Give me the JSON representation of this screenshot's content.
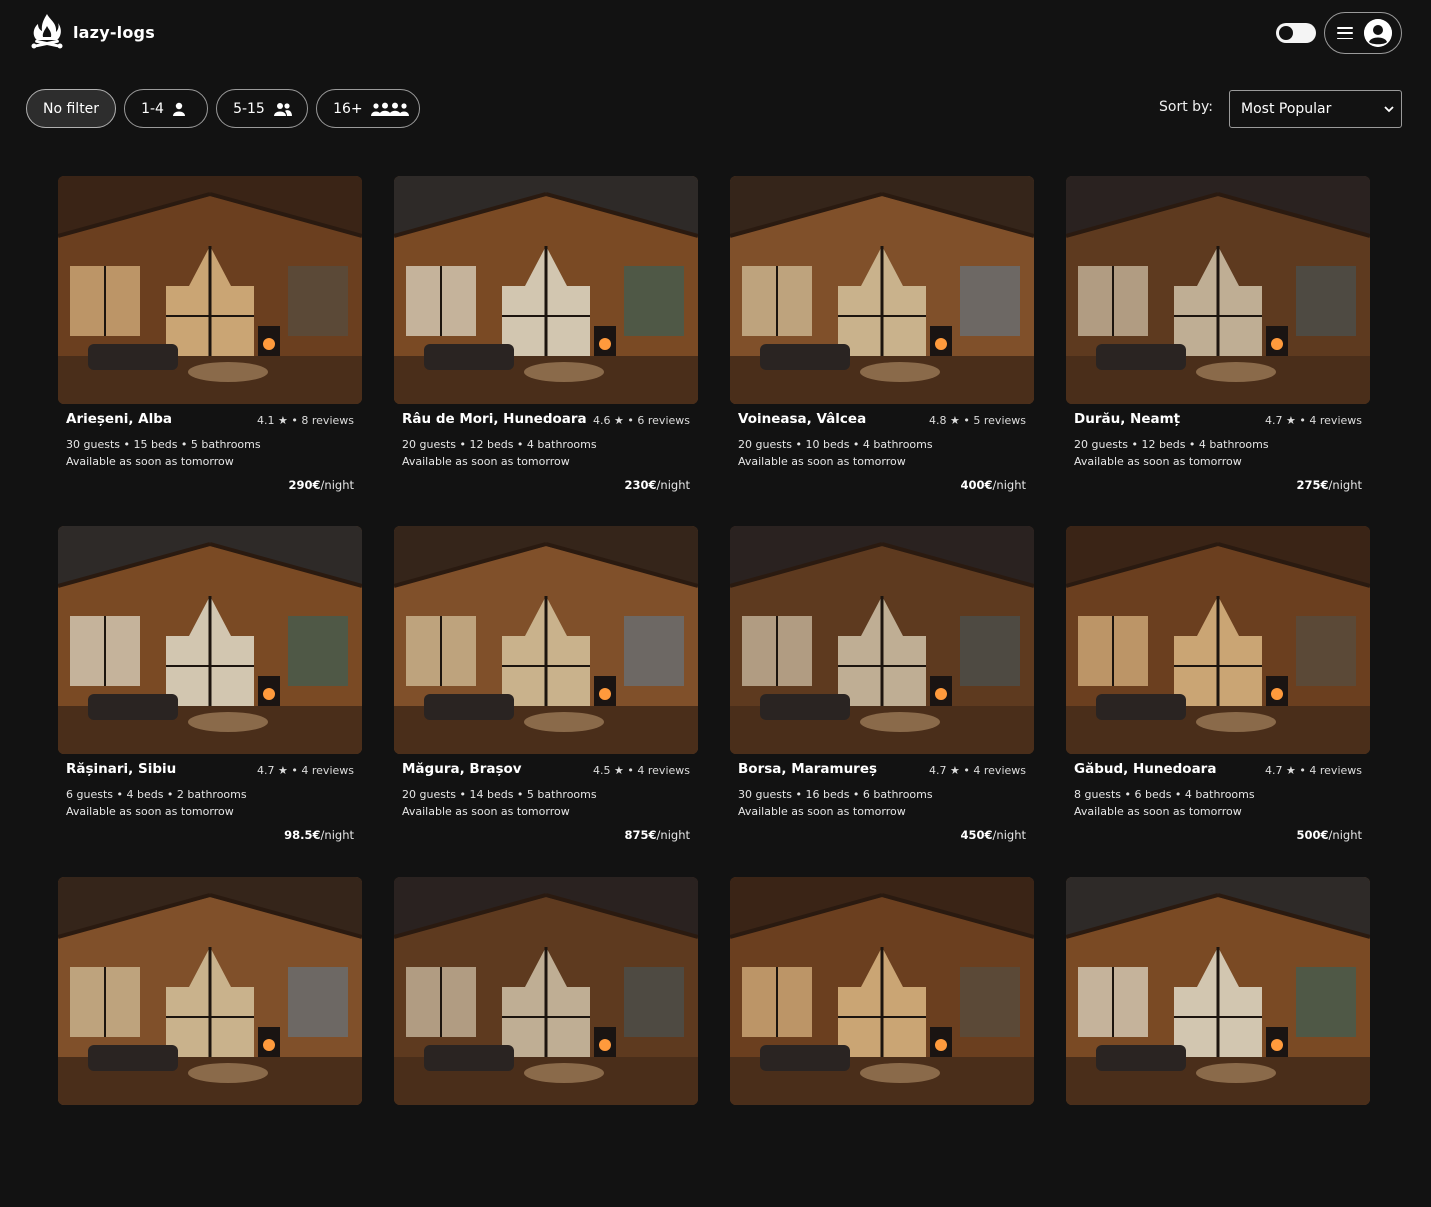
{
  "app": {
    "name": "lazy-logs"
  },
  "header": {
    "theme_toggle": "dark",
    "menu_icon": "hamburger-icon",
    "profile_icon": "user-circle-icon"
  },
  "filters": [
    {
      "label": "No filter",
      "icon": "",
      "active": true
    },
    {
      "label": "1-4",
      "icon": "single-person-icon",
      "active": false
    },
    {
      "label": "5-15",
      "icon": "two-people-icon",
      "active": false
    },
    {
      "label": "16+",
      "icon": "group-people-icon",
      "active": false
    }
  ],
  "sort": {
    "label": "Sort by:",
    "selected": "Most Popular"
  },
  "listings": [
    {
      "location": "Arieșeni, Alba",
      "rating": "4.1",
      "reviews": "8 reviews",
      "details": "30 guests • 15 beds • 5 bathrooms",
      "availability": "Available as soon as tomorrow",
      "price": "290€",
      "unit": "/night"
    },
    {
      "location": "Râu de Mori, Hunedoara",
      "rating": "4.6",
      "reviews": "6 reviews",
      "details": "20 guests • 12 beds • 4 bathrooms",
      "availability": "Available as soon as tomorrow",
      "price": "230€",
      "unit": "/night"
    },
    {
      "location": "Voineasa, Vâlcea",
      "rating": "4.8",
      "reviews": "5 reviews",
      "details": "20 guests • 10 beds • 4 bathrooms",
      "availability": "Available as soon as tomorrow",
      "price": "400€",
      "unit": "/night"
    },
    {
      "location": "Durău, Neamț",
      "rating": "4.7",
      "reviews": "4 reviews",
      "details": "20 guests • 12 beds • 4 bathrooms",
      "availability": "Available as soon as tomorrow",
      "price": "275€",
      "unit": "/night"
    },
    {
      "location": "Rășinari, Sibiu",
      "rating": "4.7",
      "reviews": "4 reviews",
      "details": "6 guests • 4 beds • 2 bathrooms",
      "availability": "Available as soon as tomorrow",
      "price": "98.5€",
      "unit": "/night"
    },
    {
      "location": "Măgura, Brașov",
      "rating": "4.5",
      "reviews": "4 reviews",
      "details": "20 guests • 14 beds • 5 bathrooms",
      "availability": "Available as soon as tomorrow",
      "price": "875€",
      "unit": "/night"
    },
    {
      "location": "Borsa, Maramureș",
      "rating": "4.7",
      "reviews": "4 reviews",
      "details": "30 guests • 16 beds • 6 bathrooms",
      "availability": "Available as soon as tomorrow",
      "price": "450€",
      "unit": "/night"
    },
    {
      "location": "Găbud, Hunedoara",
      "rating": "4.7",
      "reviews": "4 reviews",
      "details": "8 guests • 6 beds • 4 bathrooms",
      "availability": "Available as soon as tomorrow",
      "price": "500€",
      "unit": "/night"
    }
  ],
  "colors": {
    "background": "#121212",
    "text": "#f2f2f2",
    "border": "#9a9a9a",
    "wood": "#7a4a26",
    "window": "#d8d4c8"
  }
}
